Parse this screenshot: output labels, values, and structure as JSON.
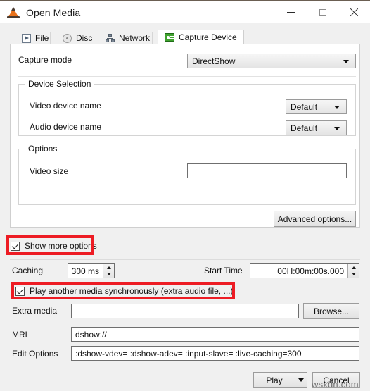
{
  "window": {
    "title": "Open Media",
    "icon": "vlc-cone-icon",
    "controls": {
      "minimize": "minimize-icon",
      "maximize": "maximize-icon",
      "close": "close-icon"
    }
  },
  "tabs": [
    {
      "label": "File",
      "icon": "file-icon",
      "active": false
    },
    {
      "label": "Disc",
      "icon": "disc-icon",
      "active": false
    },
    {
      "label": "Network",
      "icon": "network-icon",
      "active": false
    },
    {
      "label": "Capture Device",
      "icon": "capture-device-icon",
      "active": true
    }
  ],
  "capture": {
    "mode_label": "Capture mode",
    "mode_value": "DirectShow",
    "device_selection": {
      "title": "Device Selection",
      "video_label": "Video device name",
      "video_value": "Default",
      "audio_label": "Audio device name",
      "audio_value": "Default"
    },
    "options": {
      "title": "Options",
      "video_size_label": "Video size",
      "video_size_value": "",
      "video_size_placeholder": ""
    },
    "advanced_button": "Advanced options..."
  },
  "show_more_options": {
    "label": "Show more options",
    "checked": true,
    "highlighted": true
  },
  "more": {
    "caching_label": "Caching",
    "caching_value": "300 ms",
    "start_time_label": "Start Time",
    "start_time_value": "00H:00m:00s.000",
    "sync_checkbox_label": "Play another media synchronously (extra audio file, ...)",
    "sync_checked": true,
    "sync_highlighted": true,
    "extra_media_label": "Extra media",
    "extra_media_value": "",
    "browse_button": "Browse...",
    "mrl_label": "MRL",
    "mrl_value": "dshow://",
    "edit_options_label": "Edit Options",
    "edit_options_value": ":dshow-vdev= :dshow-adev=  :input-slave= :live-caching=300"
  },
  "footer": {
    "play_button": "Play",
    "play_dropdown": "chevron-down-icon",
    "cancel_button": "Cancel"
  },
  "watermark": "wsxdn.com",
  "colors": {
    "annotation_red": "#ed1c24",
    "window_bg": "#f0f0f0",
    "panel_bg": "#ffffff",
    "titlebar_accent": "#6b5f52"
  }
}
